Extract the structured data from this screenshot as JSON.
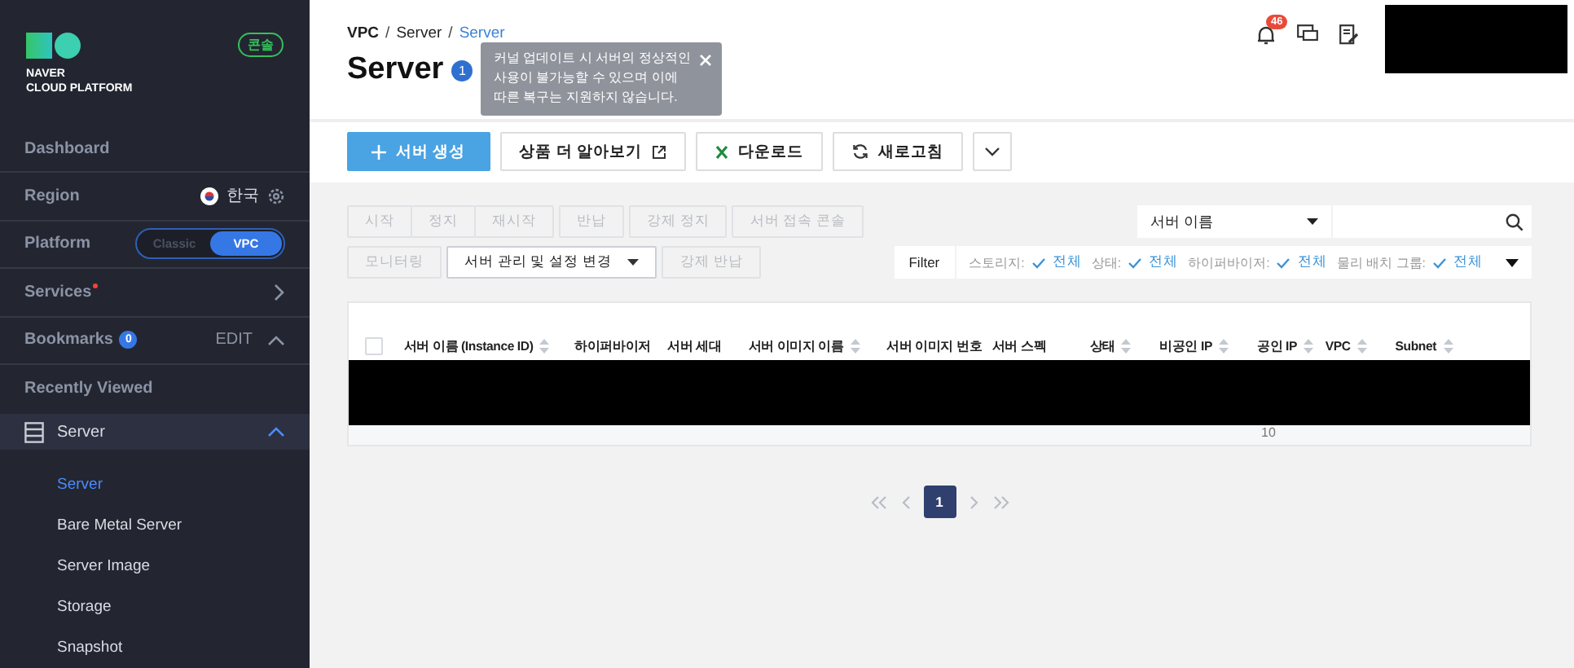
{
  "sidebar": {
    "logo_text": [
      "NAVER",
      "CLOUD PLATFORM"
    ],
    "badge": "콘솔",
    "rows": [
      {
        "kind": "link",
        "label": "Dashboard"
      },
      {
        "kind": "region",
        "label": "Region",
        "value": "한국"
      },
      {
        "kind": "platform",
        "label": "Platform",
        "options": [
          {
            "label": "Classic",
            "selected": false
          },
          {
            "label": "VPC",
            "selected": true
          }
        ]
      },
      {
        "kind": "services",
        "label": "Services",
        "new": true
      },
      {
        "kind": "bookmarks",
        "label": "Bookmarks",
        "count": "0",
        "action": "EDIT",
        "expanded": true
      },
      {
        "kind": "heading",
        "label": "Recently Viewed"
      }
    ],
    "group": {
      "label": "Server",
      "expanded": true,
      "items": [
        {
          "label": "Server",
          "selected": true
        },
        {
          "label": "Bare Metal Server",
          "selected": false
        },
        {
          "label": "Server Image",
          "selected": false
        },
        {
          "label": "Storage",
          "selected": false
        },
        {
          "label": "Snapshot",
          "selected": false
        }
      ]
    }
  },
  "breadcrumb_separator": "/",
  "breadcrumb": [
    {
      "label": "VPC",
      "current": false
    },
    {
      "label": "Server",
      "current": false
    },
    {
      "label": "Server",
      "current": true
    }
  ],
  "title": "Server",
  "title_badge": "1",
  "tooltip": "커널 업데이트 시 서버의 정상적인 사용이 불가능할 수 있으며 이에 따른 복구는 지원하지 않습니다.",
  "notifications": "46",
  "toolbar": [
    {
      "kind": "primary",
      "label": "서버 생성"
    },
    {
      "kind": "external",
      "label": "상품 더 알아보기"
    },
    {
      "kind": "download",
      "label": "다운로드"
    },
    {
      "kind": "refresh",
      "label": "새로고침"
    },
    {
      "kind": "more"
    }
  ],
  "actions": [
    [
      {
        "label": "시작",
        "disabled": true,
        "dropdown": false
      },
      {
        "label": "정지",
        "disabled": true,
        "dropdown": false
      },
      {
        "label": "재시작",
        "disabled": true,
        "dropdown": false
      },
      {
        "label": "반납",
        "disabled": true,
        "dropdown": false
      },
      {
        "label": "강제 정지",
        "disabled": true,
        "dropdown": false
      },
      {
        "label": "서버 접속 콘솔",
        "disabled": true,
        "dropdown": false
      }
    ],
    [
      {
        "label": "모니터링",
        "disabled": true,
        "dropdown": false
      },
      {
        "label": "서버 관리 및 설정 변경",
        "disabled": false,
        "dropdown": true
      },
      {
        "label": "강제 반납",
        "disabled": true,
        "dropdown": false
      }
    ]
  ],
  "search": {
    "field": "서버 이름"
  },
  "filter": {
    "label": "Filter",
    "items": [
      {
        "label": "스토리지:",
        "value": "전체"
      },
      {
        "label": "상태:",
        "value": "전체"
      },
      {
        "label": "하이퍼바이저:",
        "value": "전체"
      },
      {
        "label": "물리 배치 그룹:",
        "value": "전체"
      }
    ]
  },
  "table": {
    "select_all": {
      "checked": false
    },
    "columns": [
      {
        "label": "서버 이름 (Instance ID)",
        "sortable": true
      },
      {
        "label": "하이퍼바이저",
        "sortable": false
      },
      {
        "label": "서버 세대",
        "sortable": false
      },
      {
        "label": "서버 이미지 이름",
        "sortable": true
      },
      {
        "label": "서버 이미지 번호",
        "sortable": false
      },
      {
        "label": "서버 스펙",
        "sortable": false
      },
      {
        "label": "상태",
        "sortable": true
      },
      {
        "label": "비공인 IP",
        "sortable": true
      },
      {
        "label": "공인 IP",
        "sortable": true
      },
      {
        "label": "VPC",
        "sortable": true
      },
      {
        "label": "Subnet",
        "sortable": true
      }
    ],
    "visible_text": "10"
  },
  "pagination": [
    {
      "label": "1",
      "selected": true
    }
  ]
}
